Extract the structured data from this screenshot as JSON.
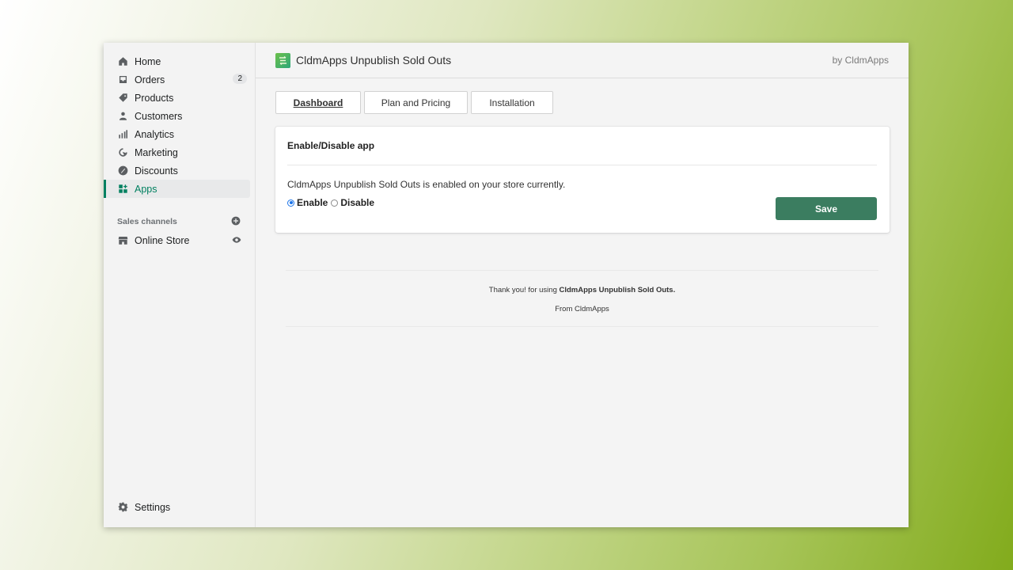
{
  "sidebar": {
    "items": [
      {
        "label": "Home",
        "icon": "home-icon"
      },
      {
        "label": "Orders",
        "icon": "orders-icon",
        "badge": "2"
      },
      {
        "label": "Products",
        "icon": "tag-icon"
      },
      {
        "label": "Customers",
        "icon": "person-icon"
      },
      {
        "label": "Analytics",
        "icon": "bar-chart-icon"
      },
      {
        "label": "Marketing",
        "icon": "marketing-icon"
      },
      {
        "label": "Discounts",
        "icon": "discount-icon"
      },
      {
        "label": "Apps",
        "icon": "apps-icon",
        "active": true
      }
    ],
    "sales_channels": {
      "heading": "Sales channels",
      "add_icon": "plus-circle-icon",
      "items": [
        {
          "label": "Online Store",
          "icon": "store-icon",
          "trail_icon": "eye-icon"
        }
      ]
    },
    "settings": {
      "label": "Settings",
      "icon": "gear-icon"
    }
  },
  "header": {
    "app_title": "CldmApps Unpublish Sold Outs",
    "by": "by CldmApps"
  },
  "tabs": [
    {
      "label": "Dashboard",
      "active": true
    },
    {
      "label": "Plan and Pricing"
    },
    {
      "label": "Installation"
    }
  ],
  "card": {
    "title": "Enable/Disable app",
    "status": "CldmApps Unpublish Sold Outs is enabled on your store currently.",
    "options": [
      {
        "label": "Enable",
        "checked": true
      },
      {
        "label": "Disable",
        "checked": false
      }
    ],
    "save_label": "Save",
    "save_color": "#3b7d60"
  },
  "footer": {
    "thanks_prefix": "Thank you! for using ",
    "thanks_app": "CldmApps Unpublish Sold Outs.",
    "from": "From CldmApps"
  },
  "colors": {
    "accent": "#008060",
    "radio": "#1a73e8"
  }
}
